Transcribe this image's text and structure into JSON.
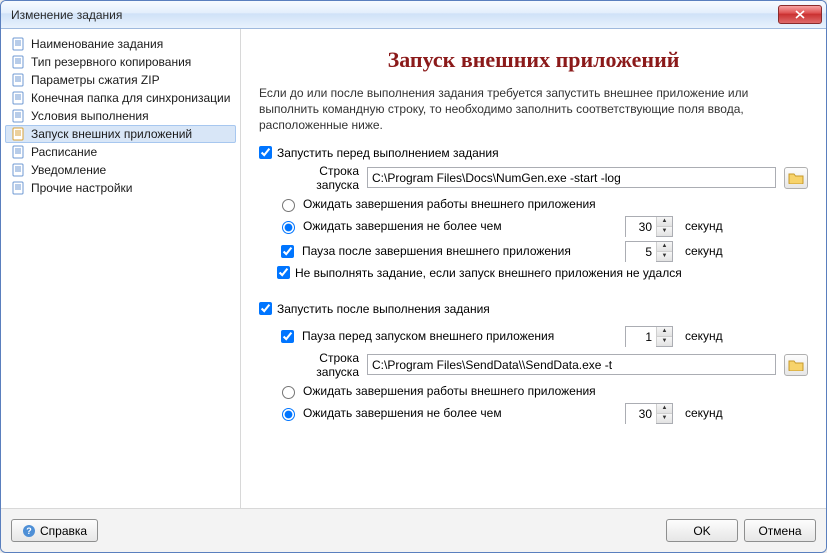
{
  "window": {
    "title": "Изменение задания"
  },
  "nav": {
    "items": [
      {
        "label": "Наименование задания"
      },
      {
        "label": "Тип резервного копирования"
      },
      {
        "label": "Параметры сжатия ZIP"
      },
      {
        "label": "Конечная папка для синхронизации"
      },
      {
        "label": "Условия выполнения"
      },
      {
        "label": "Запуск внешних приложений"
      },
      {
        "label": "Расписание"
      },
      {
        "label": "Уведомление"
      },
      {
        "label": "Прочие настройки"
      }
    ],
    "selected_index": 5
  },
  "main": {
    "heading": "Запуск внешних приложений",
    "intro": "Если до или после выполнения задания требуется запустить внешнее приложение или выполнить командную строку, то необходимо заполнить соответствующие поля ввода, расположенные ниже.",
    "before": {
      "enable_label": "Запустить перед выполнением задания",
      "enable_checked": true,
      "cmd_label": "Строка запуска",
      "cmd_value": "C:\\Program Files\\Docs\\NumGen.exe -start -log",
      "wait_complete_label": "Ожидать завершения работы внешнего приложения",
      "wait_complete_selected": false,
      "wait_timeout_label": "Ожидать завершения не более чем",
      "wait_timeout_selected": true,
      "wait_timeout_value": "30",
      "wait_timeout_unit": "секунд",
      "pause_after_label": "Пауза после завершения внешнего приложения",
      "pause_after_checked": true,
      "pause_after_value": "5",
      "pause_after_unit": "секунд",
      "skip_on_fail_label": "Не выполнять задание, если запуск внешнего приложения не удался",
      "skip_on_fail_checked": true
    },
    "after": {
      "enable_label": "Запустить после выполнения задания",
      "enable_checked": true,
      "pause_before_label": "Пауза перед запуском внешнего приложения",
      "pause_before_checked": true,
      "pause_before_value": "1",
      "pause_before_unit": "секунд",
      "cmd_label": "Строка запуска",
      "cmd_value": "C:\\Program Files\\SendData\\\\SendData.exe -t",
      "wait_complete_label": "Ожидать завершения работы внешнего приложения",
      "wait_complete_selected": false,
      "wait_timeout_label": "Ожидать завершения не более чем",
      "wait_timeout_selected": true,
      "wait_timeout_value": "30",
      "wait_timeout_unit": "секунд"
    }
  },
  "footer": {
    "help_label": "Справка",
    "ok_label": "OK",
    "cancel_label": "Отмена"
  }
}
